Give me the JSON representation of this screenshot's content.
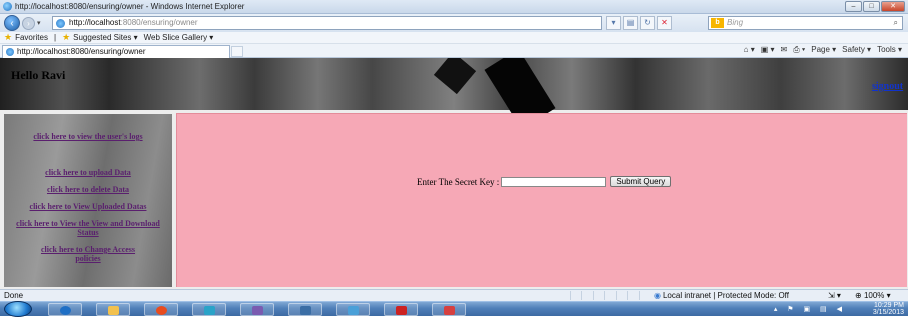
{
  "window": {
    "title": "http://localhost:8080/ensuring/owner - Windows Internet Explorer",
    "controls": [
      "–",
      "□",
      "✕"
    ]
  },
  "nav": {
    "back_icon": "back-arrow-icon",
    "address_host": "http://localhost",
    "address_rest": ":8080/ensuring/owner",
    "search_placeholder": "Bing",
    "search_logo": "b"
  },
  "favorites": {
    "label": "Favorites",
    "items": [
      "Suggested Sites ▾",
      "Web Slice Gallery ▾"
    ]
  },
  "tab": {
    "title": "http://localhost:8080/ensuring/owner"
  },
  "command_bar": {
    "items": [
      "Page ▾",
      "Safety ▾",
      "Tools ▾"
    ]
  },
  "page": {
    "greeting": "Hello Ravi",
    "signout": "signout",
    "sidebar_links": [
      "click here to view the user's logs",
      "click here to upload Data",
      "click here to delete Data",
      "click here to View Uploaded Datas",
      "click here to View the View and Download Status",
      "click here to Change Access policies"
    ],
    "secret_label": "Enter The Secret Key :",
    "secret_value": "",
    "submit_label": "Submit Query"
  },
  "status": {
    "text": "Done",
    "zone": "Local intranet | Protected Mode: Off",
    "zoom": "100%"
  },
  "taskbar": {
    "time": "10:29 PM",
    "date": "3/15/2013",
    "colors": [
      "#1f6fc5",
      "#f2c14e",
      "#e84c1e",
      "#2aa3c8",
      "#7a5bb0",
      "#3b6ea5",
      "#4aa0d8",
      "#cc2222",
      "#d64040"
    ]
  }
}
